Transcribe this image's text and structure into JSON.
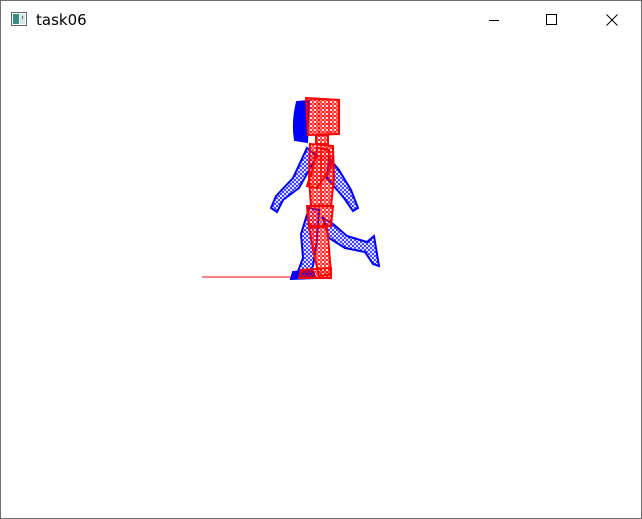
{
  "window": {
    "title": "task06",
    "icon": "app-window-icon",
    "controls": [
      "minimize-icon",
      "maximize-icon",
      "close-icon"
    ]
  },
  "scene": {
    "description_colors": {
      "front_mesh": "#ff0000",
      "back_mesh": "#0000ff",
      "background": "#ffffff"
    }
  }
}
